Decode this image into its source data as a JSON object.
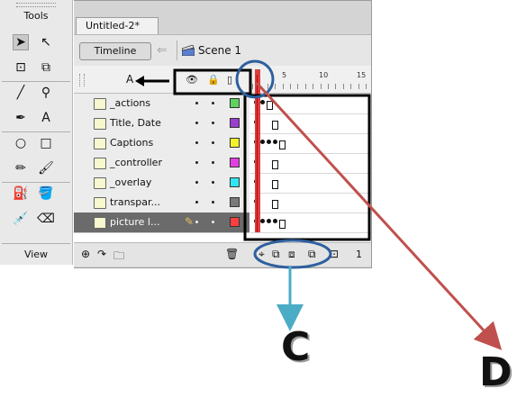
{
  "tools_panel": {
    "title": "Tools",
    "view_label": "View",
    "tools": [
      {
        "icon": "selection-arrow-icon",
        "glyph": "➤"
      },
      {
        "icon": "subselection-icon",
        "glyph": "↖"
      },
      {
        "icon": "free-transform-icon",
        "glyph": "⊡"
      },
      {
        "icon": "gradient-transform-icon",
        "glyph": "⧉"
      },
      {
        "icon": "line-icon",
        "glyph": "╱"
      },
      {
        "icon": "lasso-icon",
        "glyph": "⚲"
      },
      {
        "icon": "pen-icon",
        "glyph": "✒"
      },
      {
        "icon": "text-icon",
        "glyph": "A"
      },
      {
        "icon": "oval-icon",
        "glyph": "○"
      },
      {
        "icon": "rectangle-icon",
        "glyph": "□"
      },
      {
        "icon": "pencil-icon",
        "glyph": "✏"
      },
      {
        "icon": "brush-icon",
        "glyph": "🖌"
      },
      {
        "icon": "ink-bottle-icon",
        "glyph": "⛽"
      },
      {
        "icon": "paint-bucket-icon",
        "glyph": "🪣"
      },
      {
        "icon": "eyedropper-icon",
        "glyph": "💉"
      },
      {
        "icon": "eraser-icon",
        "glyph": "⌫"
      }
    ]
  },
  "document": {
    "tab_title": "Untitled-2*",
    "timeline_button": "Timeline",
    "scene_label": "Scene 1"
  },
  "timeline": {
    "column_letter": "A",
    "ruler_numbers": [
      "5",
      "10",
      "15"
    ],
    "layers": [
      {
        "name": "_actions",
        "color": "#5fd35f",
        "active": false
      },
      {
        "name": "Title, Date",
        "color": "#9b3fd0",
        "active": false
      },
      {
        "name": "Captions",
        "color": "#f2f22a",
        "active": false
      },
      {
        "name": "_controller",
        "color": "#e23fe2",
        "active": false
      },
      {
        "name": "_overlay",
        "color": "#2fe6f0",
        "active": false
      },
      {
        "name": "transpar...",
        "color": "#7a7a7a",
        "active": false
      },
      {
        "name": "picture l...",
        "color": "#ff3f3f",
        "active": true
      }
    ],
    "frame_count": "1"
  },
  "annotations": {
    "label_c": "C",
    "label_d": "D",
    "arrow_d_color": "#c0504d",
    "arrow_c_color": "#4bacc6",
    "circle_color": "#2e5f9e"
  }
}
